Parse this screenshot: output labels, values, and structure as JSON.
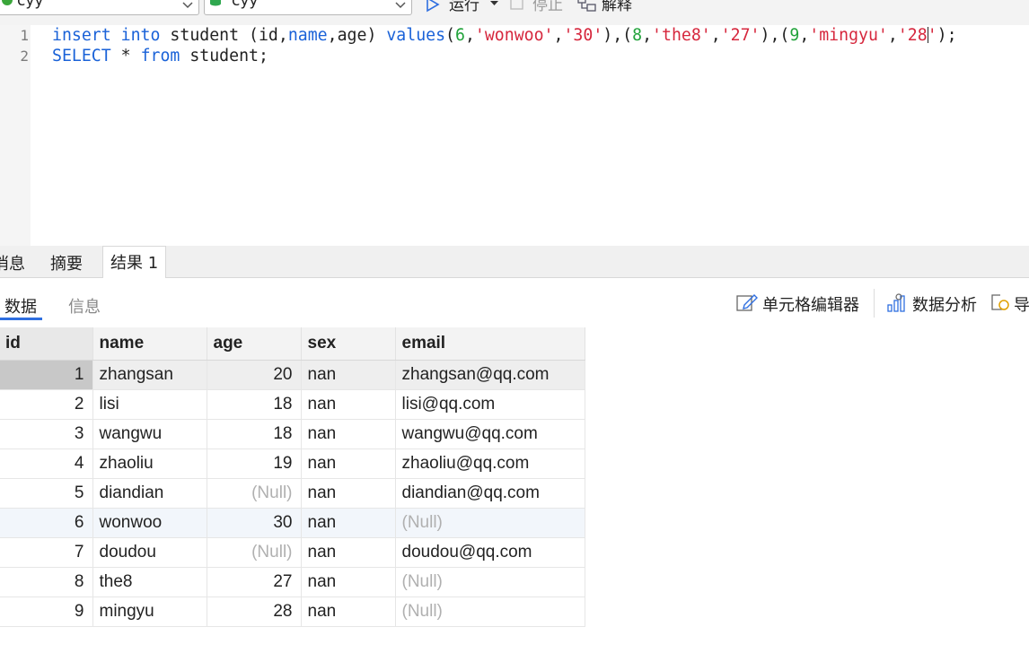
{
  "toolbar": {
    "connection": "cyy",
    "database": "cyy",
    "run_label": "运行",
    "stop_label": "停止",
    "explain_label": "解释"
  },
  "editor": {
    "line_numbers": [
      "1",
      "2"
    ],
    "line1": {
      "kw_insert": "insert",
      "kw_into": "into",
      "t_student": " student (id,",
      "kw_name": "name",
      "t_age": ",age) ",
      "kw_values": "values",
      "p1": "(",
      "n6": "6",
      "s_wonwoo": "'wonwoo'",
      "s_30": "'30'",
      "p2": "),(",
      "n8": "8",
      "s_the8": "'the8'",
      "s_27": "'27'",
      "n9": "9",
      "s_mingyu": "'mingyu'",
      "s_28a": "'28",
      "s_28b": "'",
      "end": ");",
      "comma": ","
    },
    "line2": {
      "kw_select": "SELECT",
      "star": " * ",
      "kw_from": "from",
      "rest": " student;"
    }
  },
  "result_tabs": [
    "消息",
    "摘要",
    "结果 1"
  ],
  "sub_tabs": [
    "数据",
    "信息"
  ],
  "result_toolbar": {
    "cell_editor": "单元格编辑器",
    "data_analysis": "数据分析",
    "export": "导"
  },
  "table": {
    "columns": [
      "id",
      "name",
      "age",
      "sex",
      "email"
    ],
    "null_text": "(Null)",
    "rows": [
      {
        "id": "1",
        "name": "zhangsan",
        "age": "20",
        "sex": "nan",
        "email": "zhangsan@qq.com"
      },
      {
        "id": "2",
        "name": "lisi",
        "age": "18",
        "sex": "nan",
        "email": "lisi@qq.com"
      },
      {
        "id": "3",
        "name": "wangwu",
        "age": "18",
        "sex": "nan",
        "email": "wangwu@qq.com"
      },
      {
        "id": "4",
        "name": "zhaoliu",
        "age": "19",
        "sex": "nan",
        "email": "zhaoliu@qq.com"
      },
      {
        "id": "5",
        "name": "diandian",
        "age": "(Null)",
        "sex": "nan",
        "email": "diandian@qq.com"
      },
      {
        "id": "6",
        "name": "wonwoo",
        "age": "30",
        "sex": "nan",
        "email": "(Null)"
      },
      {
        "id": "7",
        "name": "doudou",
        "age": "(Null)",
        "sex": "nan",
        "email": "doudou@qq.com"
      },
      {
        "id": "8",
        "name": "the8",
        "age": "27",
        "sex": "nan",
        "email": "(Null)"
      },
      {
        "id": "9",
        "name": "mingyu",
        "age": "28",
        "sex": "nan",
        "email": "(Null)"
      }
    ]
  },
  "colors": {
    "keyword": "#1a62d8",
    "string": "#d6273d",
    "number": "#22a33b",
    "accent": "#2f6fe0",
    "null": "#b0b0b0"
  }
}
